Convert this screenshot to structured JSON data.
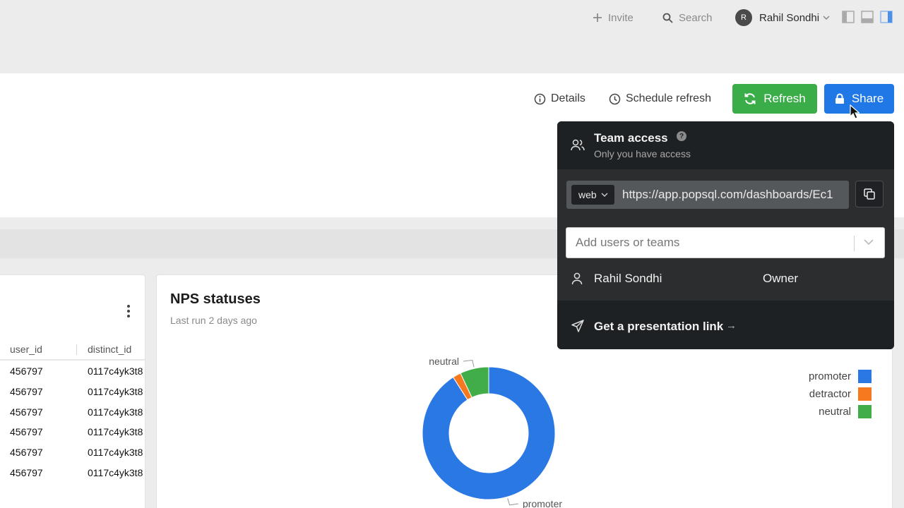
{
  "topbar": {
    "invite_label": "Invite",
    "search_label": "Search",
    "avatar_initial": "R",
    "user_name": "Rahil Sondhi"
  },
  "header": {
    "details_label": "Details",
    "schedule_label": "Schedule refresh",
    "refresh_label": "Refresh",
    "share_label": "Share"
  },
  "table": {
    "columns": [
      "user_id",
      "distinct_id"
    ],
    "rows": [
      [
        "456797",
        "0117c4yk3t8"
      ],
      [
        "456797",
        "0117c4yk3t8"
      ],
      [
        "456797",
        "0117c4yk3t8"
      ],
      [
        "456797",
        "0117c4yk3t8"
      ],
      [
        "456797",
        "0117c4yk3t8"
      ],
      [
        "456797",
        "0117c4yk3t8"
      ]
    ]
  },
  "chart_card": {
    "title": "NPS statuses",
    "subtitle": "Last run 2 days ago"
  },
  "chart_data": {
    "type": "pie",
    "donut": true,
    "categories": [
      "promoter",
      "detractor",
      "neutral"
    ],
    "values": [
      91,
      2,
      7
    ],
    "colors": [
      "#2a78e4",
      "#f7791f",
      "#41ad49"
    ],
    "legend": "top-right"
  },
  "share_popover": {
    "team_title": "Team access",
    "team_subtitle": "Only you have access",
    "help_glyph": "?",
    "link_type": "web",
    "url": "https://app.popsql.com/dashboards/Ec1",
    "add_placeholder": "Add users or teams",
    "member_name": "Rahil Sondhi",
    "member_role": "Owner",
    "presentation_label": "Get a presentation link",
    "presentation_arrow": "→"
  },
  "icons": {
    "invite": "plus-icon",
    "search": "search-icon",
    "details": "info-icon",
    "schedule": "clock-icon",
    "refresh": "refresh-icon",
    "share": "lock-icon",
    "team": "users-icon",
    "copy": "copy-icon",
    "member": "user-icon",
    "present": "send-icon"
  }
}
